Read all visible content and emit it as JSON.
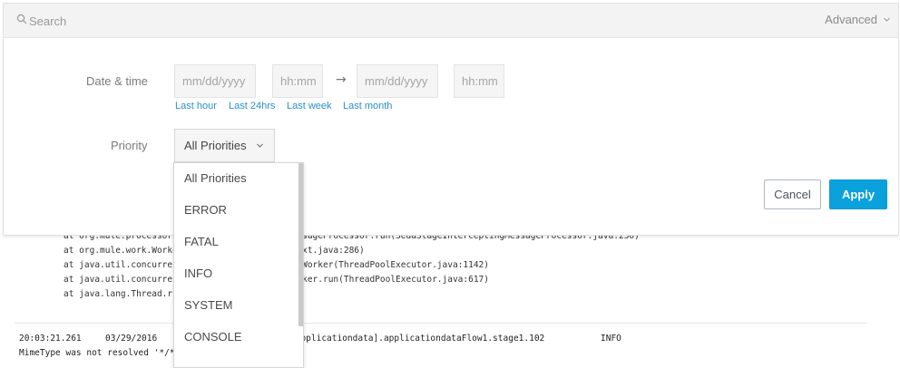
{
  "search": {
    "placeholder": "Search",
    "advanced_label": "Advanced"
  },
  "filters": {
    "date_time_label": "Date & time",
    "from_date_placeholder": "mm/dd/yyyy",
    "from_time_placeholder": "hh:mm",
    "to_date_placeholder": "mm/dd/yyyy",
    "to_time_placeholder": "hh:mm",
    "arrow": "→",
    "quick_ranges": [
      "Last hour",
      "Last 24hrs",
      "Last week",
      "Last month"
    ],
    "priority_label": "Priority",
    "priority_selected": "All Priorities",
    "priority_options": [
      "All Priorities",
      "ERROR",
      "FATAL",
      "INFO",
      "SYSTEM",
      "CONSOLE"
    ]
  },
  "actions": {
    "cancel": "Cancel",
    "apply": "Apply"
  },
  "log": {
    "stack_lines": [
      "at org.mule.processor.SedaStageInterceptingMessageProcessor.run(SedaStageInterceptingMessageProcessor.java:230)",
      "at org.mule.work.WorkerContext.run(WorkerContext.java:286)",
      "at java.util.concurrent.ThreadPoolExecutor.runWorker(ThreadPoolExecutor.java:1142)",
      "at java.util.concurrent.ThreadPoolExecutor$Worker.run(ThreadPoolExecutor.java:617)",
      "at java.lang.Thread.run(Thread.java:745)"
    ],
    "entry": {
      "time": "20:03:21.261",
      "date": "03/29/2016",
      "source": "[applicationdata].applicationdataFlow1.stage1.102",
      "priority": "INFO",
      "message": "MimeType was not resolved '*/*'"
    }
  },
  "colors": {
    "accent": "#0aa1dc",
    "link": "#2a8fcb"
  }
}
